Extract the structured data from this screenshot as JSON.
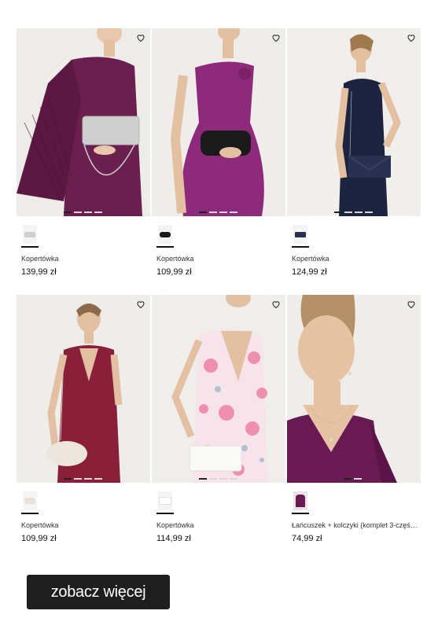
{
  "products": [
    {
      "name": "Kopertówka",
      "price": "139,99 zł",
      "bg": "#eeece9",
      "garment": "#6b1f4f",
      "accent": "#c9c9c9",
      "slides": 4,
      "active": 0
    },
    {
      "name": "Kopertówka",
      "price": "109,99 zł",
      "bg": "#efedea",
      "garment": "#8e2a7c",
      "accent": "#1a1a1a",
      "slides": 4,
      "active": 0
    },
    {
      "name": "Kopertówka",
      "price": "124,99 zł",
      "bg": "#f1efec",
      "garment": "#1d2440",
      "accent": "#2a3150",
      "slides": 4,
      "active": 0
    },
    {
      "name": "Kopertówka",
      "price": "109,99 zł",
      "bg": "#efedea",
      "garment": "#8a1f3a",
      "accent": "#ece6dc",
      "slides": 4,
      "active": 0
    },
    {
      "name": "Kopertówka",
      "price": "114,99 zł",
      "bg": "#f0eeeb",
      "garment": "#f3c8d6",
      "accent": "#f7f7f5",
      "slides": 4,
      "active": 0
    },
    {
      "name": "Łańcuszek + kolczyki (komplet 3-częściowy)",
      "price": "74,99 zł",
      "bg": "#efedea",
      "garment": "#6a1a52",
      "accent": "#d9b98a",
      "slides": 2,
      "active": 0
    }
  ],
  "more_button": {
    "label": "zobacz więcej"
  },
  "icons": {
    "wishlist": "heart-outline-icon"
  }
}
